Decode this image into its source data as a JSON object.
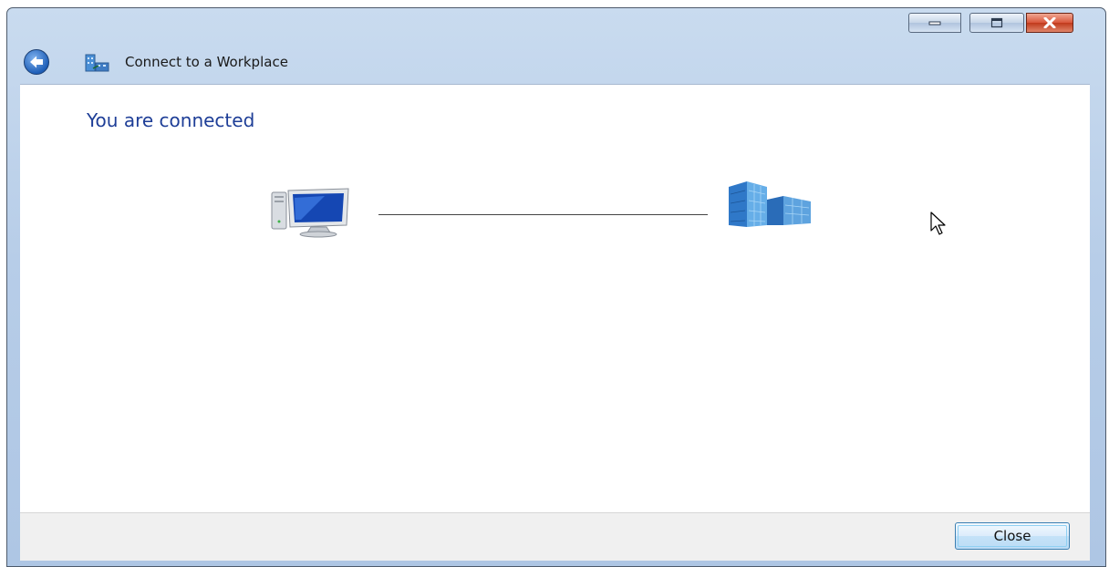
{
  "window": {
    "title": "Connect to a Workplace",
    "controls": {
      "minimize": "minimize-icon",
      "maximize": "maximize-icon",
      "close": "close-icon"
    }
  },
  "content": {
    "heading": "You are connected",
    "icons": [
      "computer-icon",
      "workplace-building-icon"
    ]
  },
  "footer": {
    "close_label": "Close"
  },
  "colors": {
    "heading": "#1e3e97",
    "titlebar": "#b7cde8",
    "close_button": "#c13a1c",
    "dialog_button_border": "#3c7fb1"
  }
}
